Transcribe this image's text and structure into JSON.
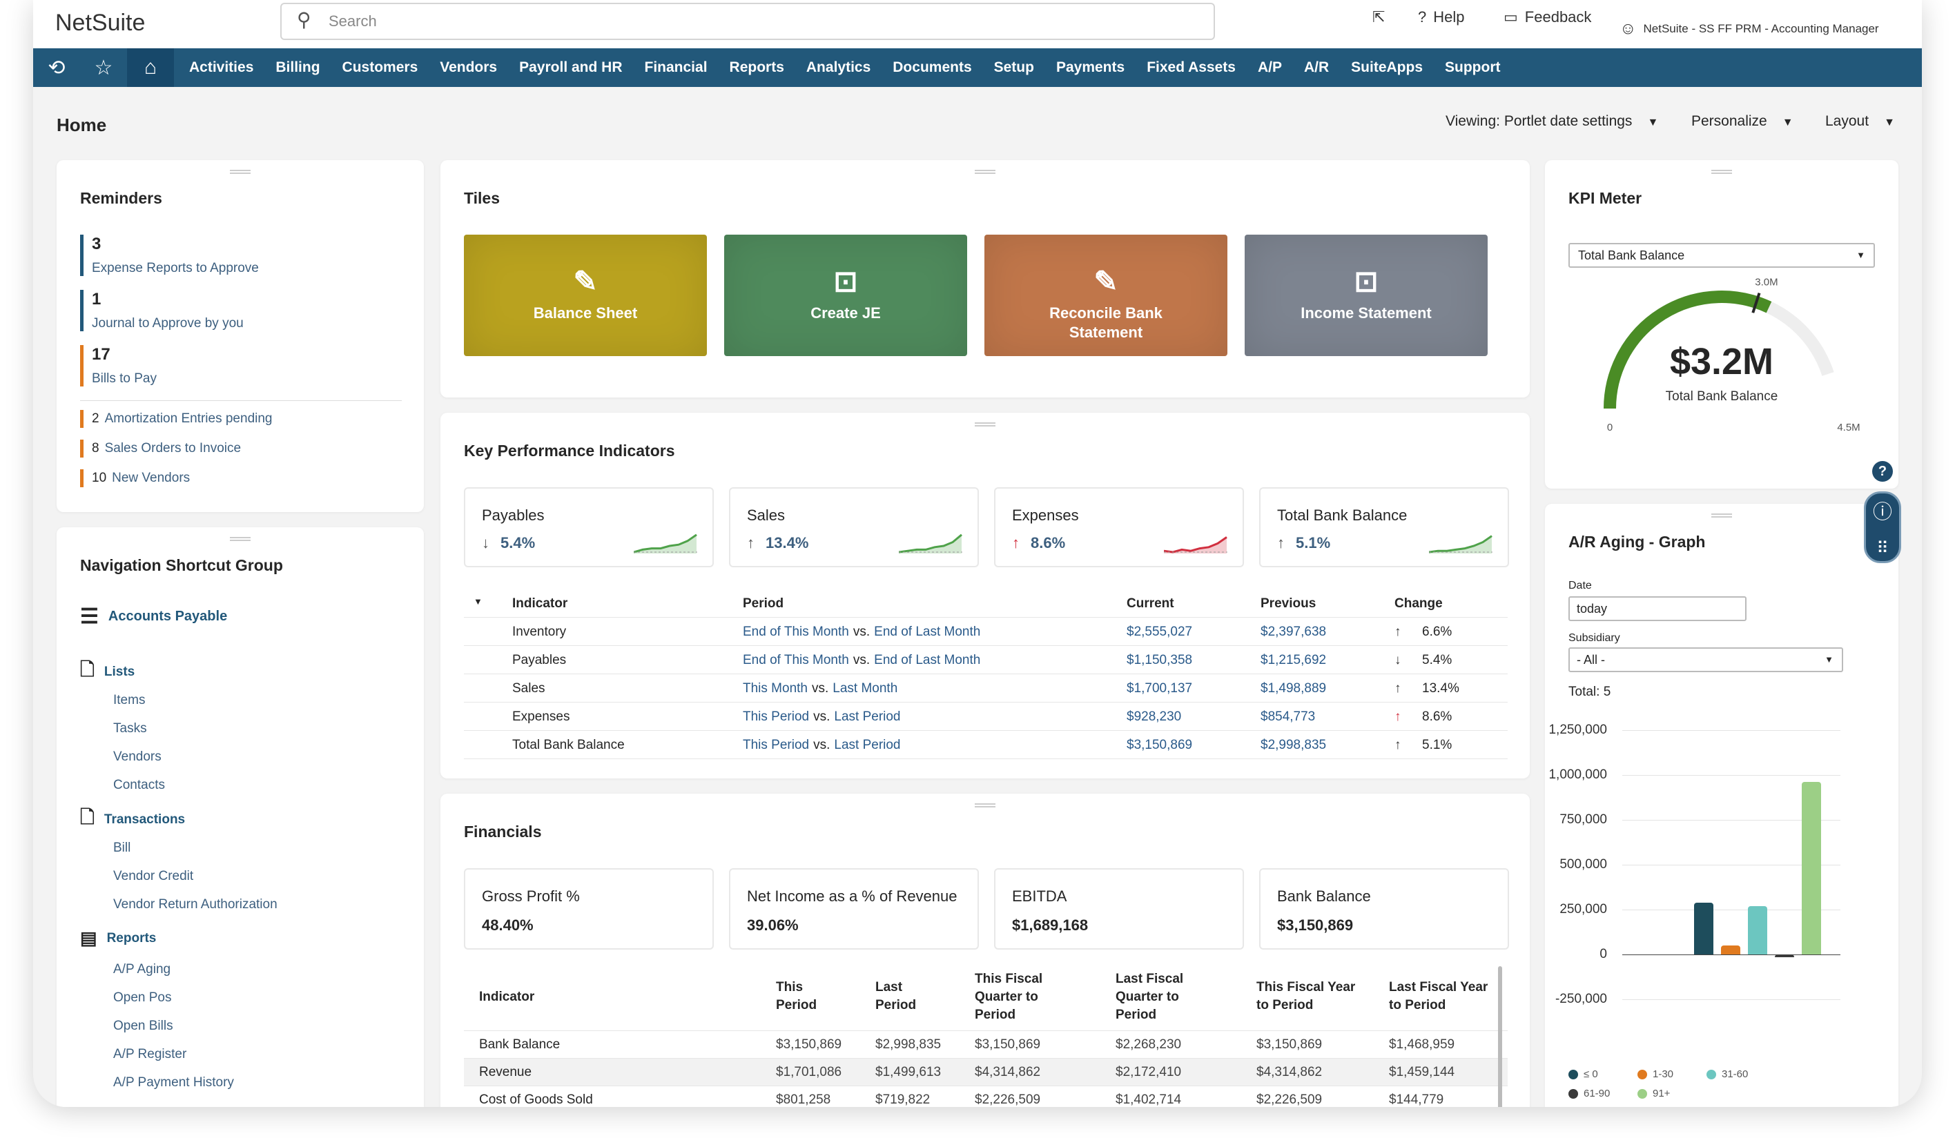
{
  "topbar": {
    "logo": "NetSuite",
    "search_placeholder": "Search",
    "help": "Help",
    "feedback": "Feedback",
    "account": "NetSuite - SS FF PRM - Accounting Manager"
  },
  "nav": {
    "items": [
      "Activities",
      "Billing",
      "Customers",
      "Vendors",
      "Payroll and HR",
      "Financial",
      "Reports",
      "Analytics",
      "Documents",
      "Setup",
      "Payments",
      "Fixed Assets",
      "A/P",
      "A/R",
      "SuiteApps",
      "Support"
    ]
  },
  "home": {
    "title": "Home",
    "viewing": "Viewing: Portlet date settings",
    "personalize": "Personalize",
    "layout": "Layout"
  },
  "reminders": {
    "title": "Reminders",
    "big": [
      {
        "count": "3",
        "label": "Expense Reports to Approve"
      },
      {
        "count": "1",
        "label": "Journal to Approve by you"
      },
      {
        "count": "17",
        "label": "Bills to Pay"
      }
    ],
    "small": [
      {
        "count": "2",
        "label": "Amortization Entries pending"
      },
      {
        "count": "8",
        "label": "Sales Orders to Invoice"
      },
      {
        "count": "10",
        "label": "New Vendors"
      }
    ]
  },
  "shortcuts": {
    "title": "Navigation Shortcut Group",
    "group": "Accounts Payable",
    "lists": {
      "label": "Lists",
      "items": [
        "Items",
        "Tasks",
        "Vendors",
        "Contacts"
      ]
    },
    "transactions": {
      "label": "Transactions",
      "items": [
        "Bill",
        "Vendor Credit",
        "Vendor Return Authorization"
      ]
    },
    "reports": {
      "label": "Reports",
      "items": [
        "A/P Aging",
        "Open Pos",
        "Open Bills",
        "A/P Register",
        "A/P Payment History"
      ]
    }
  },
  "tiles": {
    "title": "Tiles",
    "items": [
      {
        "label": "Balance Sheet",
        "color": "#b9a21f"
      },
      {
        "label": "Create JE",
        "color": "#4f8a5c"
      },
      {
        "label": "Reconcile Bank Statement",
        "color": "#c0764a"
      },
      {
        "label": "Income Statement",
        "color": "#7d8490"
      }
    ]
  },
  "kpi": {
    "title": "Key Performance Indicators",
    "boxes": [
      {
        "name": "Payables",
        "arrow": "↓",
        "pct": "5.4%",
        "color": "#4fa24a"
      },
      {
        "name": "Sales",
        "arrow": "↑",
        "pct": "13.4%",
        "color": "#4fa24a"
      },
      {
        "name": "Expenses",
        "arrow": "↑",
        "pct": "8.6%",
        "color": "#d12f3f"
      },
      {
        "name": "Total Bank Balance",
        "arrow": "↑",
        "pct": "5.1%",
        "color": "#4fa24a"
      }
    ],
    "headers": [
      "Indicator",
      "Period",
      "Current",
      "Previous",
      "Change"
    ],
    "rows": [
      {
        "indicator": "Inventory",
        "p1": "End of This Month",
        "p2": "End of Last Month",
        "current": "$2,555,027",
        "previous": "$2,397,638",
        "arrow": "↑",
        "change": "6.6%"
      },
      {
        "indicator": "Payables",
        "p1": "End of This Month",
        "p2": "End of Last Month",
        "current": "$1,150,358",
        "previous": "$1,215,692",
        "arrow": "↓",
        "change": "5.4%"
      },
      {
        "indicator": "Sales",
        "p1": "This Month",
        "p2": "Last Month",
        "current": "$1,700,137",
        "previous": "$1,498,889",
        "arrow": "↑",
        "change": "13.4%"
      },
      {
        "indicator": "Expenses",
        "p1": "This Period",
        "p2": "Last Period",
        "current": "$928,230",
        "previous": "$854,773",
        "arrow": "↑",
        "change": "8.6%"
      },
      {
        "indicator": "Total Bank Balance",
        "p1": "This Period",
        "p2": "Last Period",
        "current": "$3,150,869",
        "previous": "$2,998,835",
        "arrow": "↑",
        "change": "5.1%"
      }
    ],
    "vs": "vs."
  },
  "financials": {
    "title": "Financials",
    "boxes": [
      {
        "name": "Gross Profit %",
        "value": "48.40%"
      },
      {
        "name": "Net Income as a % of Revenue",
        "value": "39.06%"
      },
      {
        "name": "EBITDA",
        "value": "$1,689,168"
      },
      {
        "name": "Bank Balance",
        "value": "$3,150,869"
      }
    ],
    "headers": [
      "Indicator",
      "This\nPeriod",
      "Last\nPeriod",
      "This Fiscal\nQuarter to\nPeriod",
      "Last Fiscal\nQuarter to\nPeriod",
      "This Fiscal Year\nto Period",
      "Last Fiscal Year\nto Period"
    ],
    "rows": [
      [
        "Bank Balance",
        "$3,150,869",
        "$2,998,835",
        "$3,150,869",
        "$2,268,230",
        "$3,150,869",
        "$1,468,959"
      ],
      [
        "Revenue",
        "$1,701,086",
        "$1,499,613",
        "$4,314,862",
        "$2,172,410",
        "$4,314,862",
        "$1,459,144"
      ],
      [
        "Cost of Goods Sold",
        "$801,258",
        "$719,822",
        "$2,226,509",
        "$1,402,714",
        "$2,226,509",
        "$144,779"
      ]
    ]
  },
  "kpi_meter": {
    "title": "KPI Meter",
    "select": "Total Bank Balance",
    "value": "$3.2M",
    "label": "Total Bank Balance",
    "min": "0",
    "max": "4.5M",
    "target": "3.0M",
    "fraction": 0.71,
    "target_fraction": 0.667
  },
  "aging": {
    "title": "A/R Aging - Graph",
    "date_label": "Date",
    "date_value": "today",
    "subsidiary_label": "Subsidiary",
    "subsidiary_value": "- All -",
    "total": "Total: 5",
    "chart_data": {
      "type": "bar",
      "categories": [
        "≤ 0",
        "1-30",
        "31-60",
        "61-90",
        "91+"
      ],
      "values": [
        290000,
        50000,
        270000,
        -15000,
        960000
      ],
      "colors": [
        "#1e4d5c",
        "#e07a1f",
        "#6cc6c0",
        "#3a3a3a",
        "#9ccf86"
      ],
      "y_ticks": [
        "1,250,000",
        "1,000,000",
        "750,000",
        "500,000",
        "250,000",
        "0",
        "-250,000"
      ],
      "ylim": [
        -250000,
        1250000
      ]
    }
  }
}
